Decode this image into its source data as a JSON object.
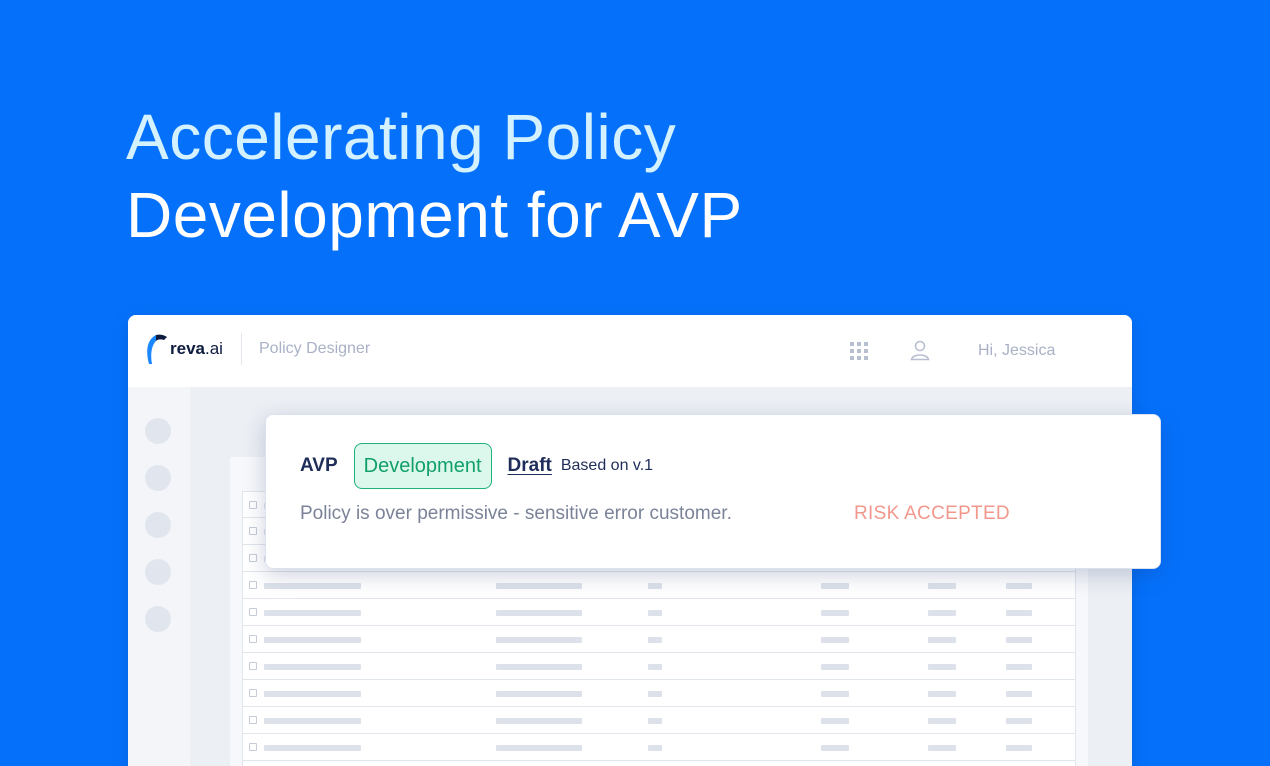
{
  "hero": {
    "line1": "Accelerating Policy",
    "line2": "Development for AVP"
  },
  "app": {
    "logo_brand": "reva",
    "logo_suffix": ".ai",
    "name": "Policy Designer",
    "greeting": "Hi, Jessica",
    "icons": {
      "apps": "grid-icon",
      "user": "user-icon"
    }
  },
  "policy_card": {
    "platform": "AVP",
    "environment": "Development",
    "status": "Draft",
    "based_on": "Based on v.1",
    "message": "Policy is over permissive - sensitive error customer.",
    "risk_label": "RISK ACCEPTED"
  },
  "colors": {
    "background": "#0571fb",
    "hero_line1": "#d4f1ff",
    "environment_text": "#12a06a",
    "environment_bg": "#dcf7ec",
    "risk": "#f2978c",
    "dark_text": "#1f2d5a"
  }
}
